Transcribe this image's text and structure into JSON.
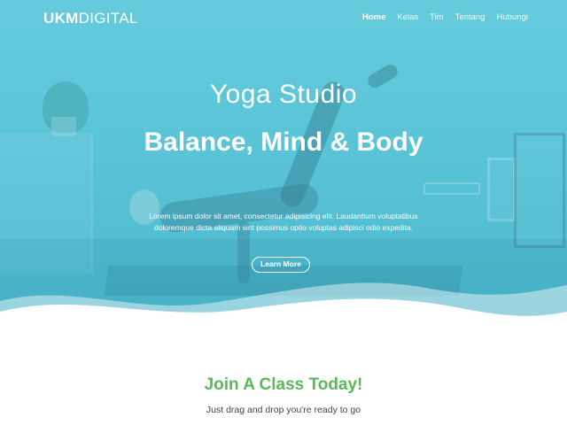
{
  "header": {
    "logo_bold": "UKM",
    "logo_light": "DIGITAL",
    "nav": [
      {
        "label": "Home",
        "active": true
      },
      {
        "label": "Kelas",
        "active": false
      },
      {
        "label": "Tim",
        "active": false
      },
      {
        "label": "Tentang",
        "active": false
      },
      {
        "label": "Hubungi",
        "active": false
      }
    ]
  },
  "hero": {
    "subtitle": "Yoga Studio",
    "title": "Balance, Mind & Body",
    "description": "Lorem ipsum dolor sit amet, consectetur adipisicing elit. Laudantium voluptatibus doloremque dicta aliquam sint possimus optio voluptas adipisci odio expedita.",
    "button_label": "Learn More",
    "overlay_color": "#5ec5d8"
  },
  "section": {
    "title": "Join A Class Today!",
    "subtitle": "Just drag and drop you're ready to go",
    "title_color": "#5cb85c"
  }
}
